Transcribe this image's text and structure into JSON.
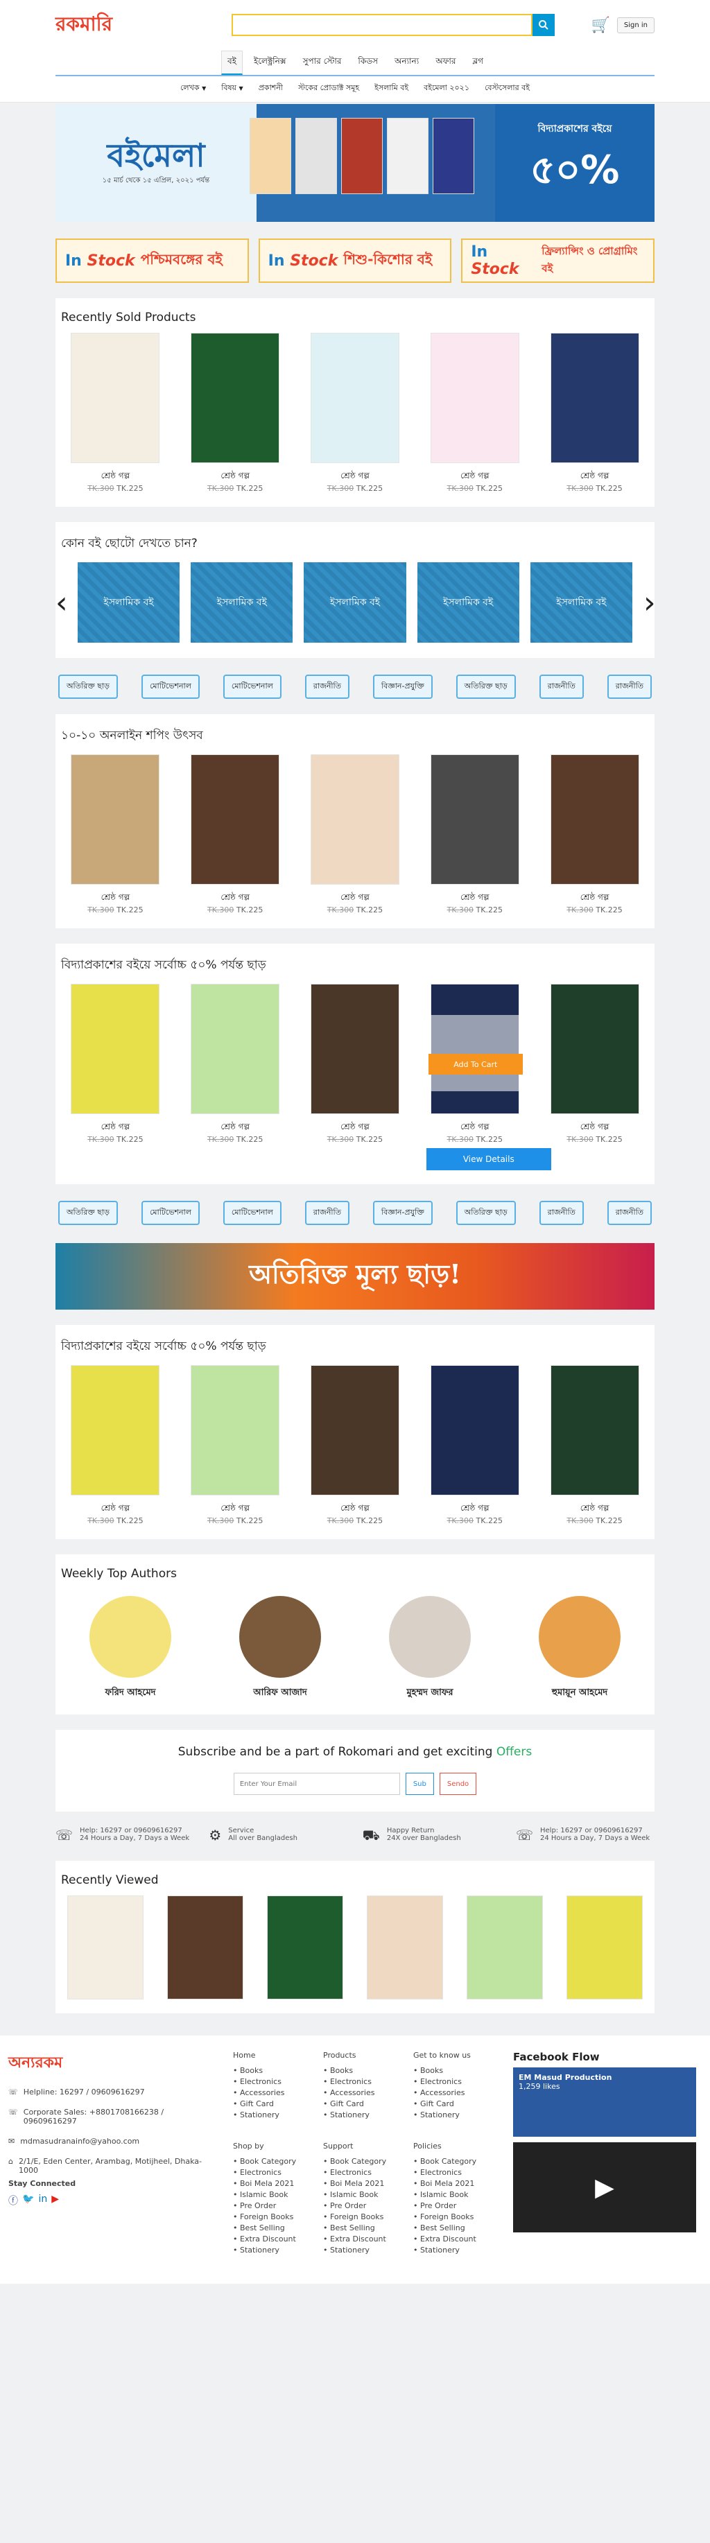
{
  "header": {
    "logo_main": "রকমারি",
    "search_placeholder": "",
    "signin": "Sign in",
    "nav_tabs": [
      "বই",
      "ইলেক্ট্রনিক্স",
      "সুপার স্টোর",
      "কিডস",
      "অন্যান্য",
      "অফার",
      "ব্লগ"
    ],
    "nav_sub": [
      "লেখক",
      "বিষয়",
      "প্রকাশনী",
      "স্টকের প্রোডাক্ট সমূহ",
      "ইসলামি বই",
      "বইমেলা ২০২১",
      "বেস্টসেলার বই"
    ]
  },
  "banner": {
    "fest": "বইমেলা",
    "fest_sub": "১৫ মার্চ থেকে ১৫ এপ্রিল, ২০২১ পর্যন্ত",
    "right_label": "বিদ্যাপ্রকাশের বইয়ে",
    "right_pct": "৫০%",
    "book_colors": [
      "#f6d7a8",
      "#e3e3e3",
      "#b33a2b",
      "#f1f1f1",
      "#2d3a8c"
    ]
  },
  "instock": [
    {
      "is": "In",
      "stock": "Stock",
      "name": "পশ্চিমবঙ্গের বই"
    },
    {
      "is": "In",
      "stock": "Stock",
      "name": "শিশু-কিশোর বই"
    },
    {
      "is": "In",
      "stock": "Stock",
      "name": "ফ্রিল্যান্সিং ও প্রোগ্রামিং বই"
    }
  ],
  "recent_sold": {
    "title": "Recently Sold Products",
    "items": [
      {
        "name": "শ্রেষ্ঠ গল্প",
        "old": "TK.300",
        "price": "TK.225",
        "color": "#f4ede2"
      },
      {
        "name": "শ্রেষ্ঠ গল্প",
        "old": "TK.300",
        "price": "TK.225",
        "color": "#1e5c2e"
      },
      {
        "name": "শ্রেষ্ঠ গল্প",
        "old": "TK.300",
        "price": "TK.225",
        "color": "#dff1f5"
      },
      {
        "name": "শ্রেষ্ঠ গল্প",
        "old": "TK.300",
        "price": "TK.225",
        "color": "#fbe7ef"
      },
      {
        "name": "শ্রেষ্ঠ গল্প",
        "old": "TK.300",
        "price": "TK.225",
        "color": "#26396b"
      }
    ]
  },
  "categories": {
    "title": "কোন বই ছোটো দেখতে চান?",
    "items": [
      "ইসলামিক বই",
      "ইসলামিক বই",
      "ইসলামিক বই",
      "ইসলামিক বই",
      "ইসলামিক বই"
    ]
  },
  "tags": [
    "অতিরিক্ত ছাড়",
    "মোটিভেশনাল",
    "মোটিভেশনাল",
    "রাজনীতি",
    "বিজ্ঞান-প্রযুক্তি",
    "অতিরিক্ত ছাড়",
    "রাজনীতি",
    "রাজনীতি"
  ],
  "festival": {
    "title": "১০-১০ অনলাইন শপিং উৎসব",
    "items": [
      {
        "name": "শ্রেষ্ঠ গল্প",
        "old": "TK.300",
        "price": "TK.225",
        "color": "#c8a878"
      },
      {
        "name": "শ্রেষ্ঠ গল্প",
        "old": "TK.300",
        "price": "TK.225",
        "color": "#5a3a28"
      },
      {
        "name": "শ্রেষ্ঠ গল্প",
        "old": "TK.300",
        "price": "TK.225",
        "color": "#efd9c3"
      },
      {
        "name": "শ্রেষ্ঠ গল্প",
        "old": "TK.300",
        "price": "TK.225",
        "color": "#4a4a4a"
      },
      {
        "name": "শ্রেষ্ঠ গল্প",
        "old": "TK.300",
        "price": "TK.225",
        "color": "#5a3a28"
      }
    ]
  },
  "vidya1": {
    "title": "বিদ্যাপ্রকাশের বইয়ে সর্বোচ্চ ৫০% পর্যন্ত ছাড়",
    "add_to_cart": "Add To Cart",
    "view_details": "View Details",
    "items": [
      {
        "name": "শ্রেষ্ঠ গল্প",
        "old": "TK.300",
        "price": "TK.225",
        "color": "#e8e04a"
      },
      {
        "name": "শ্রেষ্ঠ গল্প",
        "old": "TK.300",
        "price": "TK.225",
        "color": "#bfe3a1"
      },
      {
        "name": "শ্রেষ্ঠ গল্প",
        "old": "TK.300",
        "price": "TK.225",
        "color": "#4b3728"
      },
      {
        "name": "শ্রেষ্ঠ গল্প",
        "old": "TK.300",
        "price": "TK.225",
        "color": "#1c2a52"
      },
      {
        "name": "শ্রেষ্ঠ গল্প",
        "old": "TK.300",
        "price": "TK.225",
        "color": "#1f3f2a"
      }
    ]
  },
  "promo_text": "অতিরিক্ত মূল্য ছাড়!",
  "vidya2": {
    "title": "বিদ্যাপ্রকাশের বইয়ে সর্বোচ্চ ৫০% পর্যন্ত ছাড়",
    "items": [
      {
        "name": "শ্রেষ্ঠ গল্প",
        "old": "TK.300",
        "price": "TK.225",
        "color": "#e8e04a"
      },
      {
        "name": "শ্রেষ্ঠ গল্প",
        "old": "TK.300",
        "price": "TK.225",
        "color": "#bfe3a1"
      },
      {
        "name": "শ্রেষ্ঠ গল্প",
        "old": "TK.300",
        "price": "TK.225",
        "color": "#4b3728"
      },
      {
        "name": "শ্রেষ্ঠ গল্প",
        "old": "TK.300",
        "price": "TK.225",
        "color": "#1c2a52"
      },
      {
        "name": "শ্রেষ্ঠ গল্প",
        "old": "TK.300",
        "price": "TK.225",
        "color": "#1f3f2a"
      }
    ]
  },
  "authors": {
    "title": "Weekly Top Authors",
    "items": [
      {
        "name": "ফরিদ আহমেদ",
        "color": "#f4e27a"
      },
      {
        "name": "আরিফ আজাদ",
        "color": "#7a5a3a"
      },
      {
        "name": "মুহম্মদ জাফর",
        "color": "#d9d0c7"
      },
      {
        "name": "হুমায়ূন আহমেদ",
        "color": "#e8a04a"
      }
    ]
  },
  "subscribe": {
    "title_a": "Subscribe and be a part of Rokomari and get exciting ",
    "title_b": "Offers",
    "placeholder": "Enter Your Email",
    "btn_sub": "Sub",
    "btn_send": "Sendo"
  },
  "service": [
    {
      "l1": "Help: 16297 or 09609616297",
      "l2": "24 Hours a Day, 7 Days a Week"
    },
    {
      "l1": "Service",
      "l2": "All over Bangladesh"
    },
    {
      "l1": "Happy Return",
      "l2": "24X over Bangladesh"
    },
    {
      "l1": "Help: 16297 or 09609616297",
      "l2": "24 Hours a Day, 7 Days a Week"
    }
  ],
  "recent_viewed": {
    "title": "Recently Viewed",
    "colors": [
      "#f4ede2",
      "#5a3a28",
      "#1e5c2e",
      "#efd9c3",
      "#bfe3a1",
      "#e8e04a"
    ]
  },
  "footer": {
    "brand": "অন্যরকম",
    "helpline": "Helpline: 16297 / 09609616297",
    "corporate": "Corporate Sales: +8801708166238 / 09609616297",
    "email": "mdmasudranainfo@yahoo.com",
    "address": "2/1/E, Eden Center, Arambag, Motijheel, Dhaka-1000",
    "stay": "Stay Connected",
    "fb_title": "Facebook Flow",
    "fb_page": "EM Masud Production",
    "fb_likes": "1,259 likes",
    "cols": [
      {
        "h": "Home",
        "items": [
          "Books",
          "Electronics",
          "Accessories",
          "Gift Card",
          "Stationery"
        ]
      },
      {
        "h": "Products",
        "items": [
          "Books",
          "Electronics",
          "Accessories",
          "Gift Card",
          "Stationery"
        ]
      },
      {
        "h": "Get to know us",
        "items": [
          "Books",
          "Electronics",
          "Accessories",
          "Gift Card",
          "Stationery"
        ]
      },
      {
        "h": "Shop by",
        "items": [
          "Book Category",
          "Electronics",
          "Boi Mela 2021",
          "Islamic Book",
          "Pre Order",
          "Foreign Books",
          "Best Selling",
          "Extra Discount",
          "Stationery"
        ]
      },
      {
        "h": "Support",
        "items": [
          "Book Category",
          "Electronics",
          "Boi Mela 2021",
          "Islamic Book",
          "Pre Order",
          "Foreign Books",
          "Best Selling",
          "Extra Discount",
          "Stationery"
        ]
      },
      {
        "h": "Policies",
        "items": [
          "Book Category",
          "Electronics",
          "Boi Mela 2021",
          "Islamic Book",
          "Pre Order",
          "Foreign Books",
          "Best Selling",
          "Extra Discount",
          "Stationery"
        ]
      }
    ]
  }
}
